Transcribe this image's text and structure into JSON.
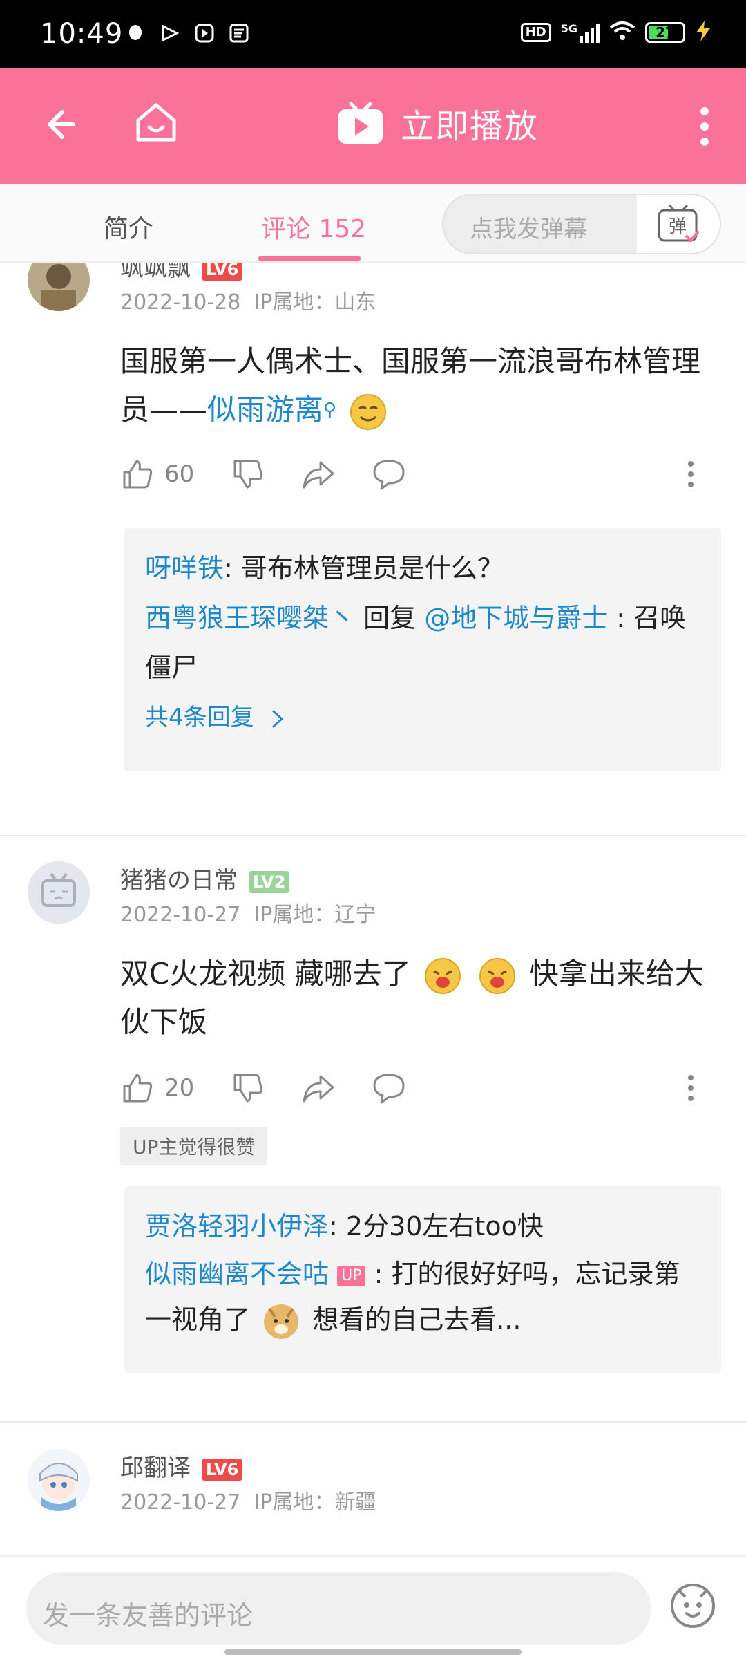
{
  "status_bar": {
    "time": "10:49",
    "network": "5G",
    "battery": "27"
  },
  "header": {
    "play_label": "立即播放"
  },
  "tabs": {
    "intro": "简介",
    "comments": "评论 152",
    "danmaku_placeholder": "点我发弹幕"
  },
  "comments": [
    {
      "user": "飒飒飘",
      "level": "LV6",
      "date": "2022-10-28",
      "ip": "IP属地：山东",
      "text_prefix": "国服第一人偶术士、国服第一流浪哥布林管理员——",
      "text_link": "似雨游离",
      "likes": "60",
      "replies": [
        {
          "user": "呀咩铁",
          "text": ": 哥布林管理员是什么？"
        },
        {
          "user": "西粤狼王琛嘤桀丶",
          "text": " 回复 ",
          "mention": "@地下城与爵士",
          "text2": " : 召唤僵尸"
        }
      ],
      "more_replies": "共4条回复"
    },
    {
      "user": "猪猪の日常",
      "level": "LV2",
      "date": "2022-10-27",
      "ip": "IP属地：辽宁",
      "text_a": "双C火龙视频 藏哪去了",
      "text_b": "快拿出来给大伙下饭",
      "likes": "20",
      "tag": "UP主觉得很赞",
      "replies": [
        {
          "user": "贾洛轻羽小伊泽",
          "text": ": 2分30左右too快"
        },
        {
          "user": "似雨幽离不会咕",
          "badge": "UP",
          "text": " : 打的很好好吗，忘记录第一视角了",
          "text2": " 想看的自己去看..."
        }
      ]
    },
    {
      "user": "邱翻译",
      "level": "LV6",
      "date": "2022-10-27",
      "ip": "IP属地：新疆"
    }
  ],
  "bottom": {
    "placeholder": "发一条友善的评论"
  }
}
